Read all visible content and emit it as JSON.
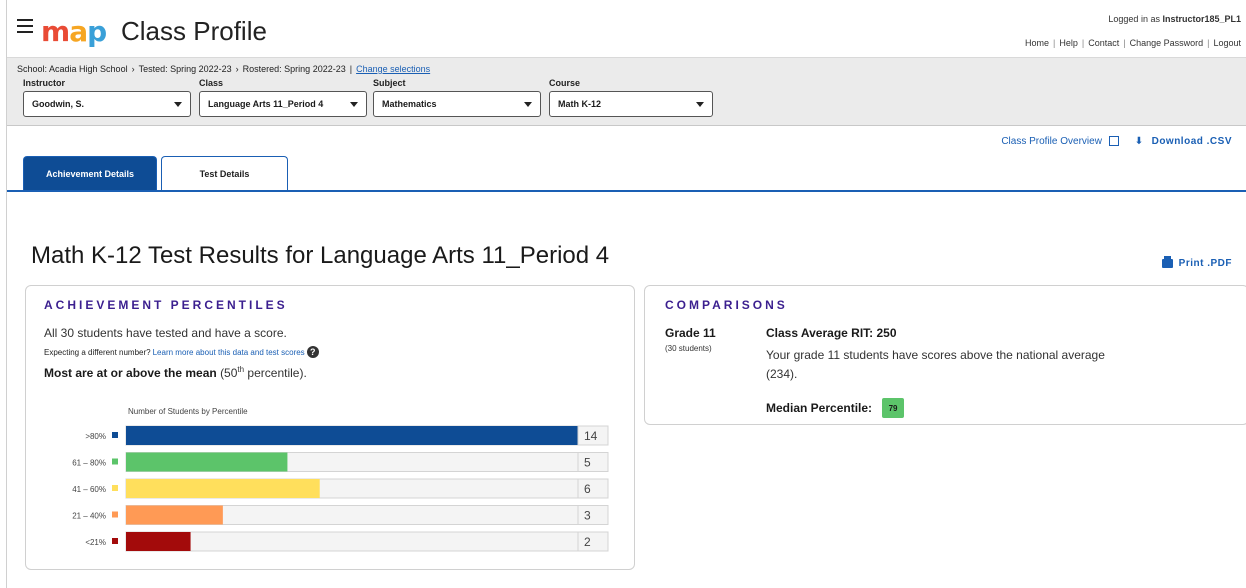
{
  "app": {
    "logo_text": "map",
    "title": "Class Profile"
  },
  "user": {
    "logged_in_prefix": "Logged in as",
    "username": "Instructor185_PL1"
  },
  "top_links": [
    "Home",
    "Help",
    "Contact",
    "Change Password",
    "Logout"
  ],
  "breadcrumb": {
    "school": "School: Acadia High School",
    "tested": "Tested: Spring 2022-23",
    "rostered": "Rostered: Spring 2022-23",
    "change_link": "Change selections"
  },
  "selectors": {
    "instructor": {
      "label": "Instructor",
      "value": "Goodwin, S."
    },
    "class": {
      "label": "Class",
      "value": "Language Arts 11_Period 4"
    },
    "subject": {
      "label": "Subject",
      "value": "Mathematics"
    },
    "course": {
      "label": "Course",
      "value": "Math K-12"
    }
  },
  "actions": {
    "overview": "Class Profile Overview",
    "download": "Download .CSV",
    "print": "Print .PDF"
  },
  "tabs": {
    "achievement": "Achievement Details",
    "test": "Test Details"
  },
  "heading": "Math K-12 Test Results for Language Arts 11_Period 4",
  "achievement": {
    "title": "ACHIEVEMENT PERCENTILES",
    "line1": "All 30 students have tested and have a score.",
    "line2_prefix": "Expecting a different number?",
    "line2_link": "Learn more about this data and test scores",
    "line3_bold": "Most are at or above the mean",
    "line3_rest_a": "(50",
    "line3_sup": "th",
    "line3_rest_b": "percentile)."
  },
  "chart_data": {
    "type": "bar",
    "orientation": "horizontal",
    "title": "Number of Students by Percentile",
    "categories": [
      ">80%",
      "61 – 80%",
      "41 – 60%",
      "21 – 40%",
      "<21%"
    ],
    "values": [
      14,
      5,
      6,
      3,
      2
    ],
    "colors": [
      "#0e4c95",
      "#5cc46a",
      "#ffdf5c",
      "#ff9a55",
      "#a30b0b"
    ],
    "xlim": [
      0,
      14
    ]
  },
  "comparisons": {
    "title": "COMPARISONS",
    "grade": "Grade 11",
    "grade_count": "(30 students)",
    "class_avg": "Class Average RIT: 250",
    "description": "Your grade 11 students have scores above the national average (234).",
    "median_label": "Median Percentile:",
    "median_value": "79",
    "median_color": "#5cc46a"
  }
}
